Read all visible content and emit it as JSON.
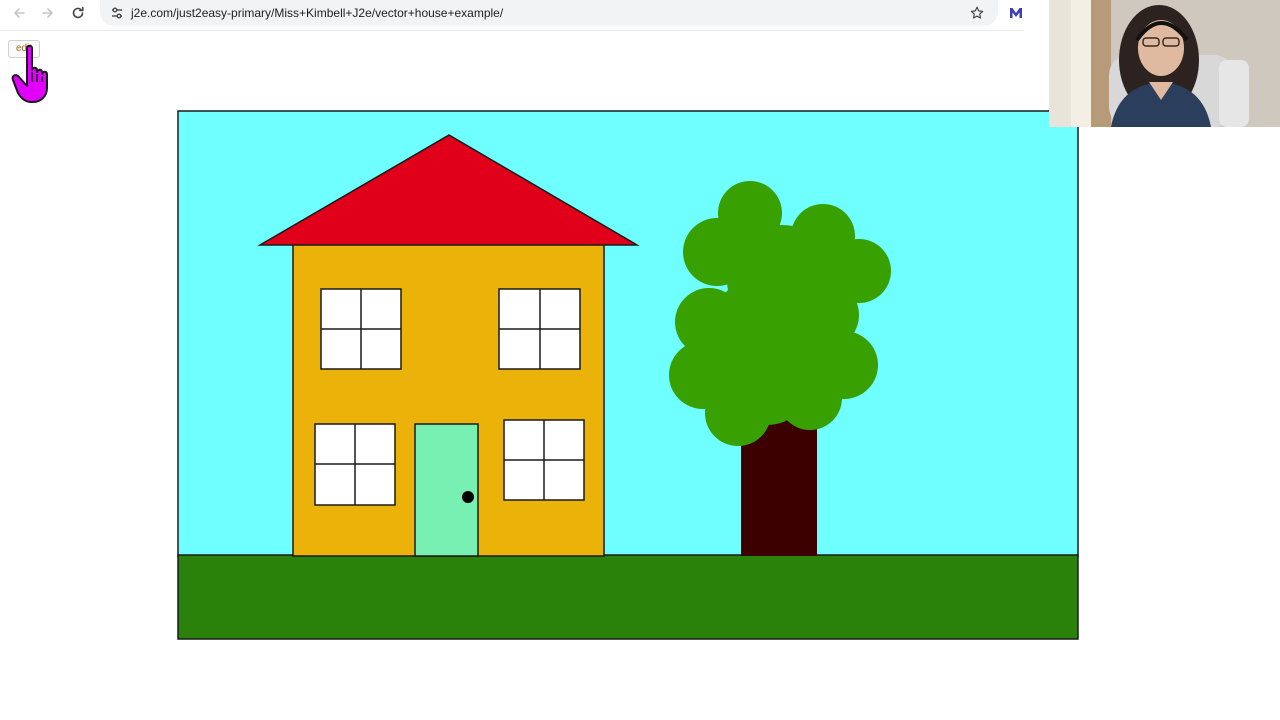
{
  "browser": {
    "url": "j2e.com/just2easy-primary/Miss+Kimbell+J2e/vector+house+example/",
    "back_icon": "arrow-left-icon",
    "forward_icon": "arrow-right-icon",
    "reload_icon": "reload-icon",
    "site_settings_icon": "tune-icon",
    "bookmark_icon": "star-outline-icon",
    "extension_icon": "m-logo-icon"
  },
  "page": {
    "edit_label": "edit"
  },
  "scene": {
    "elements": [
      "sky",
      "roof",
      "house-wall",
      "window",
      "window",
      "window",
      "window",
      "door",
      "door-knob",
      "tree-trunk",
      "tree-canopy",
      "grass"
    ],
    "colors": {
      "sky": "#70ffff",
      "roof": "#e0001a",
      "wall": "#ebb20a",
      "window": "#ffffff",
      "door": "#77f0b2",
      "trunk": "#3c0000",
      "canopy": "#38a000",
      "grass": "#2b820a",
      "outline": "#1a1a1a"
    }
  },
  "colors": {
    "cursor": "#e100ff",
    "toolbar_bg": "#ffffff",
    "omnibox_bg": "#f1f3f4"
  }
}
